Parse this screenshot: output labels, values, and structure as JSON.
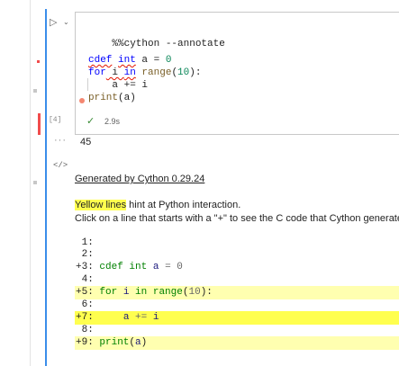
{
  "cell": {
    "run_icon": "▷",
    "chevron_icon": "⌄",
    "execution_count": "[4]",
    "status_icon": "✓",
    "duration": "2.9s"
  },
  "code": {
    "line1": "%%cython --annotate",
    "line3": {
      "kw1": "cdef",
      "type": "int",
      "rest": " a = ",
      "num": "0"
    },
    "line4": {
      "kw1": "for",
      "var": " i ",
      "kw2": "in",
      "fn": " range",
      "open": "(",
      "num": "10",
      "close": "):"
    },
    "line5": "    a += i",
    "line6": {
      "fn": "print",
      "rest": "(a)"
    }
  },
  "output": {
    "ellipsis": "···",
    "value": "45",
    "html_icon": "</>",
    "generated_by": "Generated by Cython 0.29.24",
    "hint_highlight": "Yellow lines",
    "hint_rest": " hint at Python interaction.",
    "click_text": "Click on a line that starts with a \"+\" to see the C code that Cython generated for it.",
    "annotated": [
      {
        "prefix": " 1: ",
        "code": ""
      },
      {
        "prefix": " 2: ",
        "code": ""
      },
      {
        "prefix": "+3: ",
        "code": "cdef int a = 0"
      },
      {
        "prefix": " 4: ",
        "code": ""
      },
      {
        "prefix": "+5: ",
        "code": "for i in range(10):"
      },
      {
        "prefix": " 6: ",
        "code": ""
      },
      {
        "prefix": "+7: ",
        "code": "    a += i"
      },
      {
        "prefix": " 8: ",
        "code": ""
      },
      {
        "prefix": "+9: ",
        "code": "print(a)"
      }
    ]
  },
  "colors": {
    "accent": "#3b8eea",
    "error": "#f14c4c",
    "success": "#388a34",
    "highlight_strong": "#ffff4f",
    "highlight_light": "#ffffb0"
  }
}
